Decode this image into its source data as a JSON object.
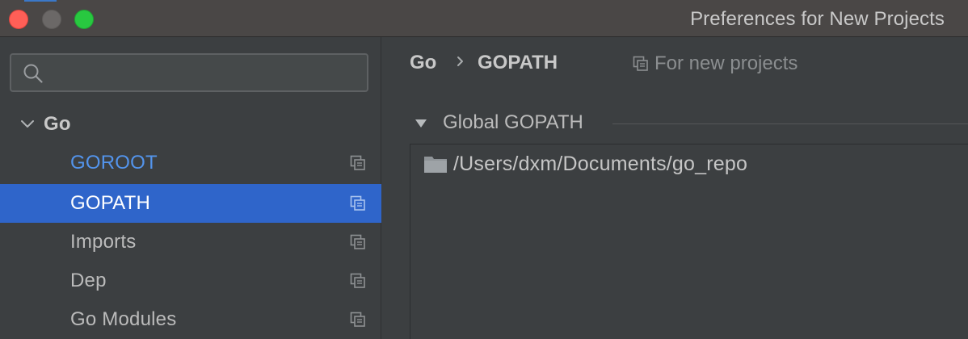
{
  "window": {
    "title": "Preferences for New Projects"
  },
  "sidebar": {
    "search": {
      "value": "",
      "placeholder": ""
    },
    "group": {
      "label": "Go",
      "expanded": true
    },
    "items": [
      {
        "label": "GOROOT",
        "selected": false,
        "link_color": "#5394ec"
      },
      {
        "label": "GOPATH",
        "selected": true
      },
      {
        "label": "Imports",
        "selected": false
      },
      {
        "label": "Dep",
        "selected": false
      },
      {
        "label": "Go Modules",
        "selected": false
      }
    ],
    "selected_color": "#2f65ca"
  },
  "main": {
    "breadcrumb": {
      "root": "Go",
      "current": "GOPATH",
      "scope_label": "For new projects"
    },
    "section": {
      "title": "Global GOPATH",
      "expanded": true
    },
    "paths": [
      {
        "value": "/Users/dxm/Documents/go_repo",
        "icon": "folder-icon"
      }
    ]
  }
}
